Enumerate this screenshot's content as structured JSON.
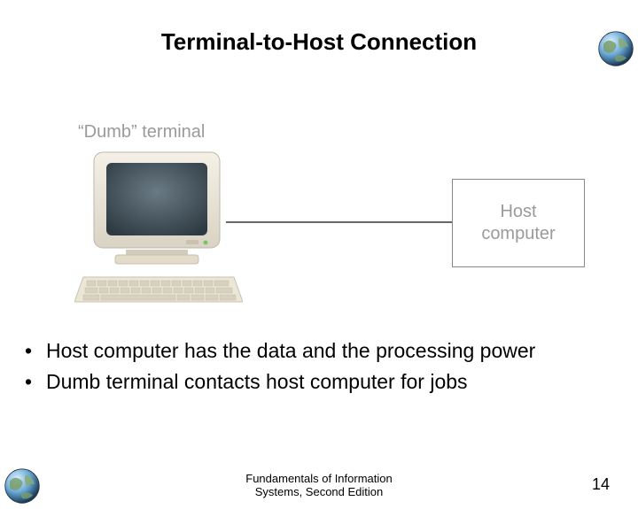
{
  "title": "Terminal-to-Host Connection",
  "diagram": {
    "terminal_label": "“Dumb” terminal",
    "host_label_line1": "Host",
    "host_label_line2": "computer"
  },
  "bullets": [
    "Host computer has the data and the processing power",
    "Dumb terminal contacts host computer for jobs"
  ],
  "footer": {
    "line1": "Fundamentals of Information",
    "line2": "Systems, Second Edition"
  },
  "page_number": "14"
}
